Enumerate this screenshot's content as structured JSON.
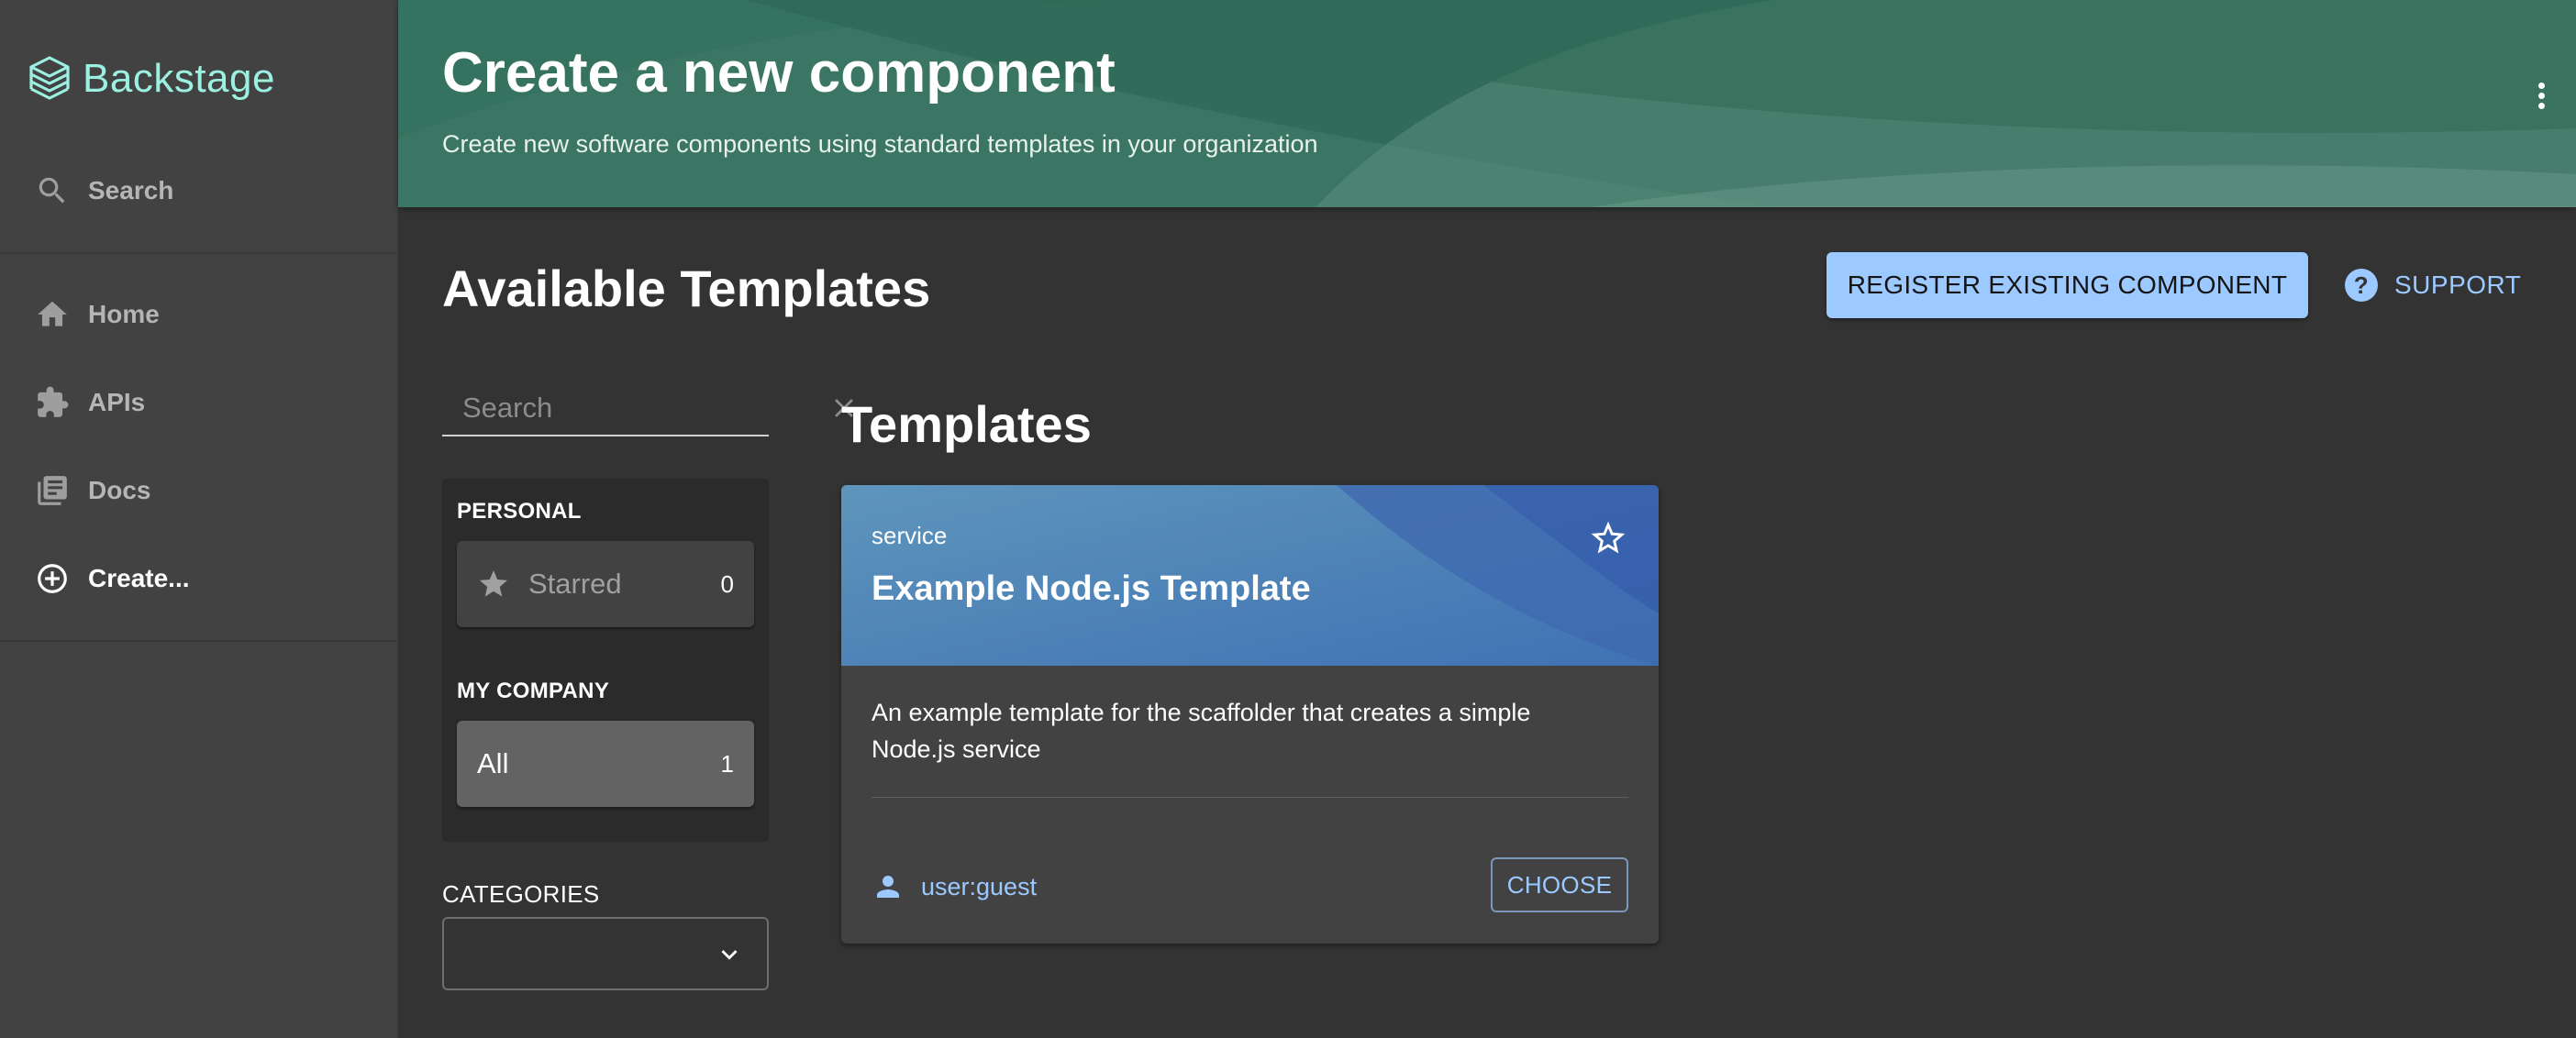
{
  "sidebar": {
    "logo_text": "Backstage",
    "search_label": "Search",
    "items": [
      {
        "label": "Home",
        "icon": "home-icon"
      },
      {
        "label": "APIs",
        "icon": "puzzle-icon"
      },
      {
        "label": "Docs",
        "icon": "library-books-icon"
      },
      {
        "label": "Create...",
        "icon": "add-circle-icon",
        "active": true
      }
    ]
  },
  "header": {
    "title": "Create a new component",
    "subtitle": "Create new software components using standard templates in your organization"
  },
  "content": {
    "title": "Available Templates",
    "register_button": "REGISTER EXISTING COMPONENT",
    "support_label": "SUPPORT"
  },
  "filters": {
    "search_placeholder": "Search",
    "personal_heading": "PERSONAL",
    "starred": {
      "label": "Starred",
      "count": "0"
    },
    "company_heading": "MY COMPANY",
    "all": {
      "label": "All",
      "count": "1"
    },
    "categories_label": "CATEGORIES",
    "categories_value": ""
  },
  "templates": {
    "heading": "Templates",
    "cards": [
      {
        "type": "service",
        "title": "Example Node.js Template",
        "description": "An example template for the scaffolder that creates a simple Node.js service",
        "owner": "user:guest",
        "action": "CHOOSE"
      }
    ]
  },
  "colors": {
    "brand_teal": "#9bf0e1",
    "header_green": "#35725f",
    "accent_blue": "#9cc9ff",
    "card_header_blue": "#4f8ab8"
  }
}
